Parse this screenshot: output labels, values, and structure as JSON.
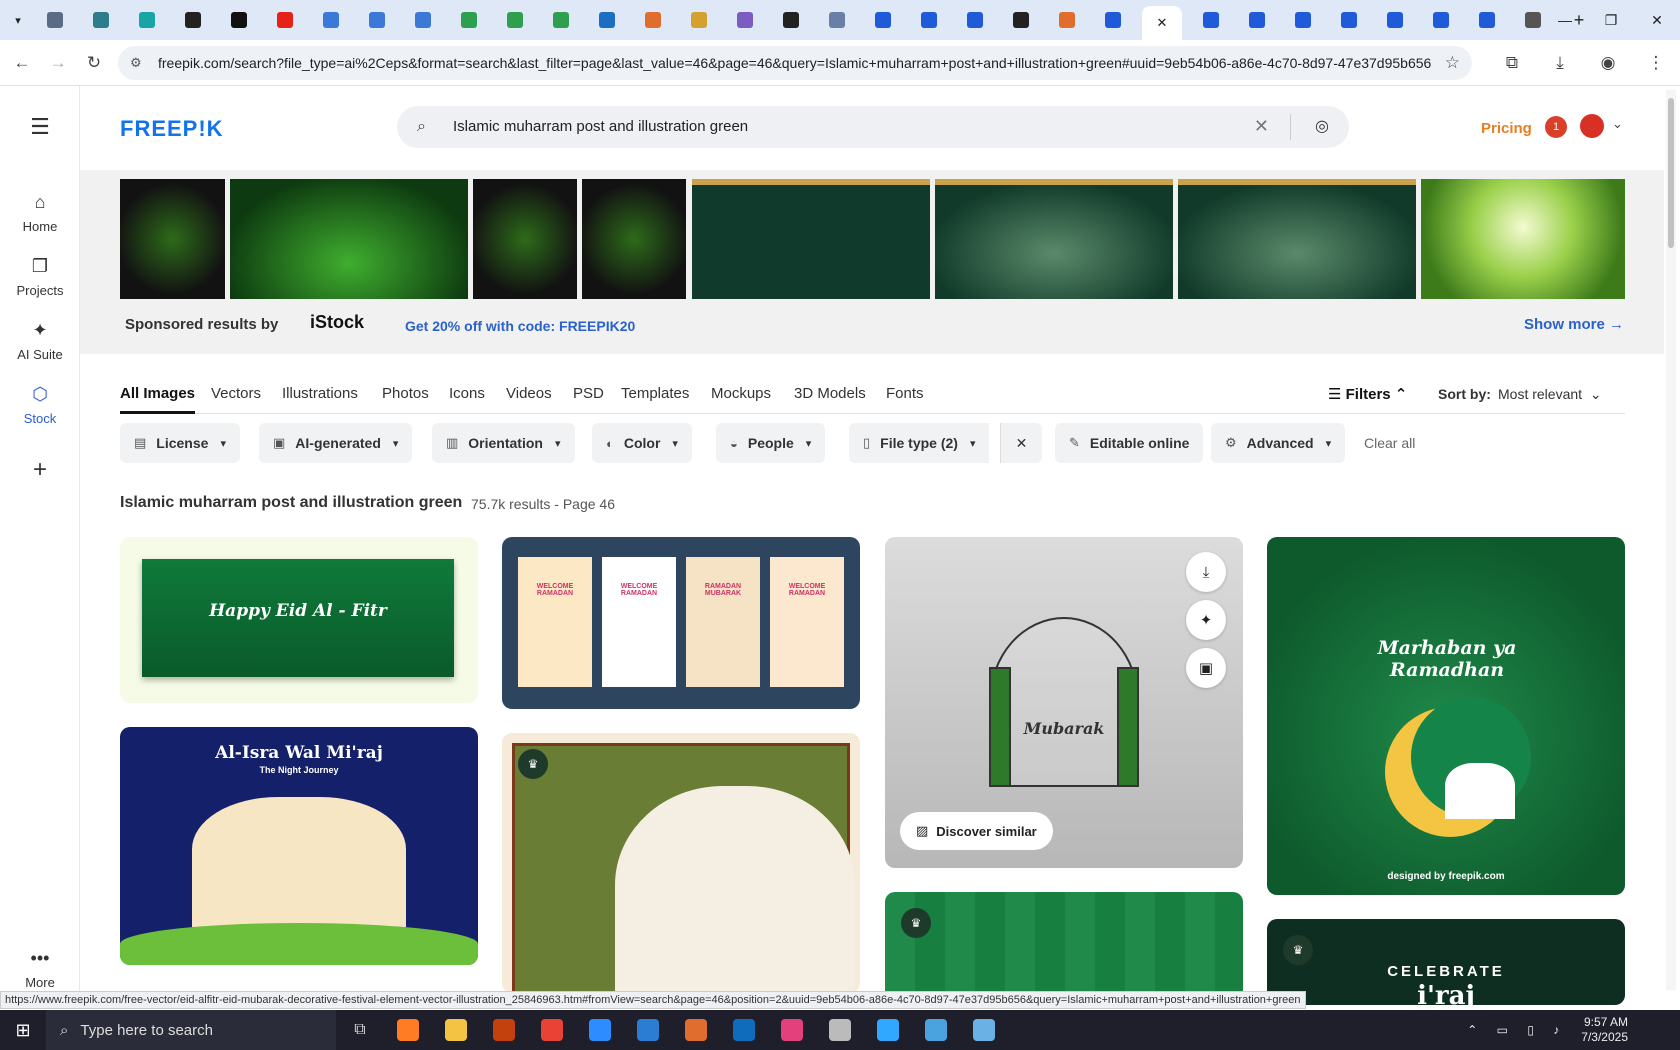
{
  "browser": {
    "tab_close": "✕",
    "new_tab": "+",
    "url": "freepik.com/search?file_type=ai%2Ceps&format=search&last_filter=page&last_value=46&page=46&query=Islamic+muharram+post+and+illustration+green#uuid=9eb54b06-a86e-4c70-8d97-47e37d95b656",
    "favicon_colors": [
      "#5a6b85",
      "#2e7d8c",
      "#1aa5a5",
      "#222",
      "#111",
      "#e62117",
      "#3c78d8",
      "#3c78d8",
      "#3c78d8",
      "#2e9e4f",
      "#2e9e4f",
      "#2e9e4f",
      "#1b6ec2",
      "#e06d2e",
      "#d4a02e",
      "#7a5cc2",
      "#222",
      "#6a7fa6",
      "#1f5ad9",
      "#1f5ad9",
      "#1f5ad9",
      "#222",
      "#e06d2e",
      "#1f5ad9"
    ],
    "favicon_colors_right": [
      "#1f5ad9",
      "#1f5ad9",
      "#1f5ad9",
      "#1f5ad9",
      "#1f5ad9",
      "#1f5ad9",
      "#1f5ad9",
      "#555"
    ]
  },
  "header": {
    "logo": "FREEP!K",
    "search_query": "Islamic muharram post and illustration green",
    "pricing": "Pricing",
    "notification_count": "1"
  },
  "sidebar": {
    "items": [
      {
        "label": "Home",
        "icon": "⌂"
      },
      {
        "label": "Projects",
        "icon": "❐"
      },
      {
        "label": "AI Suite",
        "icon": "✦"
      },
      {
        "label": "Stock",
        "icon": "⬡"
      }
    ],
    "more": "More"
  },
  "sponsored": {
    "by": "Sponsored results by",
    "provider": "iStock",
    "promo": "Get 20% off with code: FREEPIK20",
    "show_more": "Show more →"
  },
  "tabs": {
    "items": [
      "All Images",
      "Vectors",
      "Illustrations",
      "Photos",
      "Icons",
      "Videos",
      "PSD",
      "Templates",
      "Mockups",
      "3D Models",
      "Fonts"
    ],
    "filters": "Filters",
    "sort_label": "Sort by:",
    "sort_value": "Most relevant"
  },
  "chips": [
    "License",
    "AI-generated",
    "Orientation",
    "Color",
    "People",
    "File type (2)",
    "Editable online",
    "Advanced"
  ],
  "clear_all": "Clear all",
  "results": {
    "title": "Islamic muharram post and illustration green",
    "count": "75.7k results",
    "page": " - Page 46"
  },
  "cards": {
    "eid": "Happy Eid Al - Fitr",
    "israj": "Al-Isra Wal Mi'raj",
    "israj_sub": "The Night Journey",
    "ramadhan": "Marhaban ya Ramadhan",
    "ramadhan_credit": "designed by freepik.com",
    "celebrate": "CELEBRATE",
    "celebrate_big": "i'raj",
    "stories": [
      "WELCOME RAMADAN",
      "WELCOME RAMADAN",
      "RAMADAN MUBARAK",
      "WELCOME RAMADAN"
    ],
    "discover": "Discover similar",
    "mubarak": "Mubarak"
  },
  "status_url": "https://www.freepik.com/free-vector/eid-alfitr-eid-mubarak-decorative-festival-element-vector-illustration_25846963.htm#fromView=search&page=46&position=2&uuid=9eb54b06-a86e-4c70-8d97-47e37d95b656&query=Islamic+muharram+post+and+illustration+green",
  "taskbar": {
    "search_placeholder": "Type here to search",
    "time": "9:57 AM",
    "date": "7/3/2025",
    "apps": [
      "#ff7b24",
      "#f3c443",
      "#c2410c",
      "#ea4335",
      "#2d8cff",
      "#2b7cd3",
      "#e06d2e",
      "#0f6cbd",
      "#e4407b",
      "#bbb",
      "#31a8ff",
      "#4aa3df",
      "#6ab1e6"
    ]
  }
}
